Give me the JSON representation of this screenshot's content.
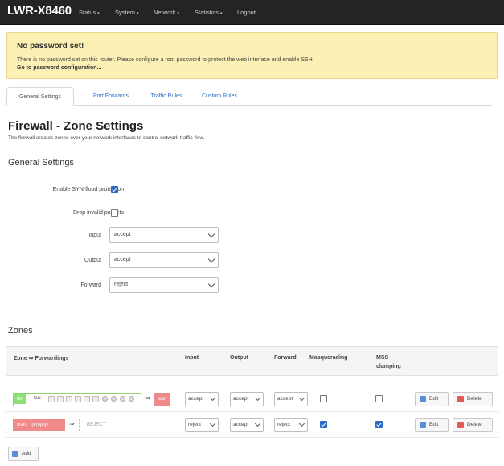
{
  "navbar": {
    "brand": "LWR-X8460",
    "items": [
      {
        "label": "Status",
        "has_menu": true
      },
      {
        "label": "System",
        "has_menu": true
      },
      {
        "label": "Network",
        "has_menu": true
      },
      {
        "label": "Statistics",
        "has_menu": true
      },
      {
        "label": "Logout",
        "has_menu": false
      }
    ],
    "caret": "▾"
  },
  "alert": {
    "title": "No password set!",
    "text": "There is no password set on this router. Please configure a root password to protect the web interface and enable SSH.",
    "link": "Go to password configuration..."
  },
  "tabs": [
    {
      "label": "General Settings",
      "active": true
    },
    {
      "label": "Port Forwards",
      "active": false
    },
    {
      "label": "Traffic Rules",
      "active": false
    },
    {
      "label": "Custom Rules",
      "active": false
    }
  ],
  "page": {
    "title": "Firewall - Zone Settings",
    "description": "The firewall creates zones over your network interfaces to control network traffic flow."
  },
  "general": {
    "title": "General Settings",
    "syn_flood": {
      "label": "Enable SYN-flood protection",
      "checked": true
    },
    "drop_invalid": {
      "label": "Drop invalid packets",
      "checked": false
    },
    "input": {
      "label": "Input",
      "value": "accept"
    },
    "output": {
      "label": "Output",
      "value": "accept"
    },
    "forward": {
      "label": "Forward",
      "value": "reject"
    }
  },
  "zones": {
    "title": "Zones",
    "headers": {
      "zone": "Zone ⇒ Forwardings",
      "input": "Input",
      "output": "Output",
      "forward": "Forward",
      "masq": "Masquerading",
      "mss1": "MSS",
      "mss2": "clamping"
    },
    "rows": [
      {
        "zone": "lan",
        "interface": "lan:",
        "forward_to": "wan",
        "input": "accept",
        "output": "accept",
        "forward": "accept",
        "masquerading": false,
        "mss_clamping": false
      },
      {
        "zone": "wan:",
        "interface": "(empty)",
        "forward_to": "REJECT",
        "input": "reject",
        "output": "accept",
        "forward": "reject",
        "masquerading": true,
        "mss_clamping": true
      }
    ],
    "edit_label": "Edit",
    "delete_label": "Delete",
    "add_label": "Add",
    "equals": "⇒"
  },
  "colors": {
    "navbar": "#242424",
    "alert_bg": "#fcf0b5",
    "link": "#2a6bc6",
    "lan": "#90e07a",
    "wan": "#f08a8a"
  }
}
